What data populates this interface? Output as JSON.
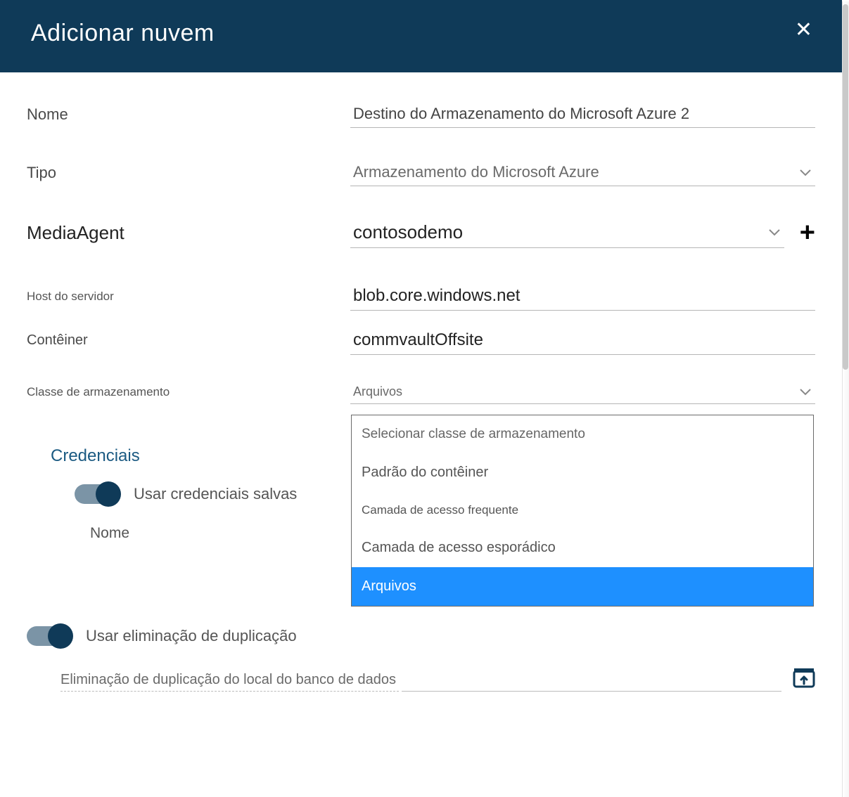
{
  "header": {
    "title": "Adicionar nuvem"
  },
  "form": {
    "name_label": "Nome",
    "name_value": "Destino do Armazenamento do Microsoft Azure 2",
    "type_label": "Tipo",
    "type_value": "Armazenamento do Microsoft Azure",
    "mediaagent_label": "MediaAgent",
    "mediaagent_value": "contosodemo",
    "server_host_label": "Host do servidor",
    "server_host_value": "blob.core.windows.net",
    "container_label": "Contêiner",
    "container_value": "commvaultOffsite",
    "storage_class_label": "Classe de armazenamento",
    "storage_class_value": "Arquivos",
    "storage_class_options": {
      "header": "Selecionar classe de armazenamento",
      "opt0": "Padrão do contêiner",
      "opt1": "Camada de acesso frequente",
      "opt2": "Camada de acesso esporádico",
      "opt3": "Arquivos"
    }
  },
  "credentials": {
    "section_title": "Credenciais",
    "use_saved_label": "Usar credenciais salvas",
    "name_label": "Nome"
  },
  "dedup": {
    "use_dedup_label": "Usar eliminação de duplicação",
    "db_location_label": "Eliminação de duplicação do local do banco de dados"
  }
}
